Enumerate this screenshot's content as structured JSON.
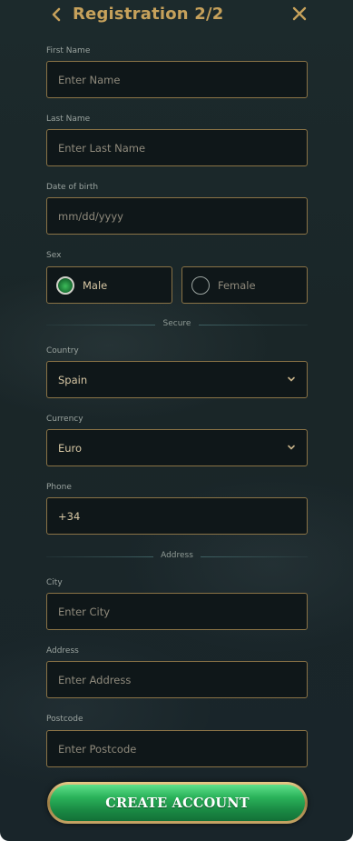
{
  "header": {
    "title": "Registration 2/2",
    "back_icon": "chevron-left-icon",
    "close_icon": "close-icon",
    "accent_color": "#c6a15b"
  },
  "form": {
    "first_name": {
      "label": "First Name",
      "placeholder": "Enter Name",
      "value": ""
    },
    "last_name": {
      "label": "Last Name",
      "placeholder": "Enter Last Name",
      "value": ""
    },
    "dob": {
      "label": "Date of birth",
      "placeholder": "mm/dd/yyyy",
      "value": ""
    },
    "sex": {
      "label": "Sex",
      "options": [
        "Male",
        "Female"
      ],
      "selected": "Male"
    },
    "secure_divider": "Secure",
    "country": {
      "label": "Country",
      "value": "Spain"
    },
    "currency": {
      "label": "Currency",
      "value": "Euro"
    },
    "phone": {
      "label": "Phone",
      "value": "+34"
    },
    "address_divider": "Address",
    "city": {
      "label": "City",
      "placeholder": "Enter City",
      "value": ""
    },
    "address": {
      "label": "Address",
      "placeholder": "Enter Address",
      "value": ""
    },
    "postcode": {
      "label": "Postcode",
      "placeholder": "Enter Postcode",
      "value": ""
    }
  },
  "submit": {
    "label": "CREATE ACCOUNT",
    "color": "#2ab25a"
  }
}
